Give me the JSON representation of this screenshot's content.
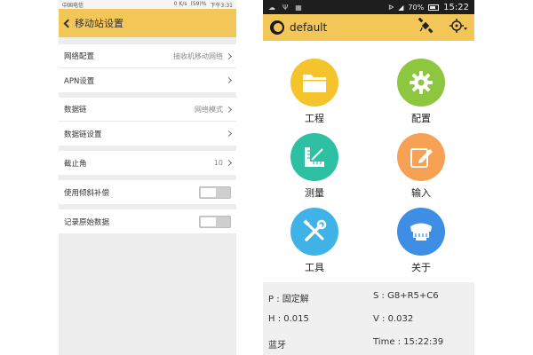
{
  "left_phone": {
    "status_bar": {
      "carrier": "中国电信",
      "net_speed": "0 K/s",
      "battery": "(59)%",
      "time": "下午3:31"
    },
    "header": {
      "title": "移动站设置"
    },
    "groups": [
      {
        "rows": [
          {
            "label": "网络配置",
            "value": "接收机移动网络"
          },
          {
            "label": "APN设置",
            "value": ""
          }
        ]
      },
      {
        "rows": [
          {
            "label": "数据链",
            "value": "网络模式"
          },
          {
            "label": "数据链设置",
            "value": ""
          }
        ]
      },
      {
        "rows": [
          {
            "label": "截止角",
            "value": "10"
          }
        ]
      },
      {
        "rows": [
          {
            "label": "使用倾斜补偿",
            "toggle": false
          }
        ]
      },
      {
        "rows": [
          {
            "label": "记录原始数据",
            "toggle": false
          }
        ]
      }
    ]
  },
  "right_phone": {
    "status_bar": {
      "battery": "70%",
      "time": "15:22"
    },
    "header": {
      "title": "default"
    },
    "tiles": [
      {
        "label": "工程",
        "color": "#f5c32c",
        "icon": "folder-icon"
      },
      {
        "label": "配置",
        "color": "#8dc63f",
        "icon": "gear-icon"
      },
      {
        "label": "测量",
        "color": "#2dc0a2",
        "icon": "ruler-icon"
      },
      {
        "label": "输入",
        "color": "#f7a154",
        "icon": "edit-icon"
      },
      {
        "label": "工具",
        "color": "#3fb3e8",
        "icon": "tools-icon"
      },
      {
        "label": "关于",
        "color": "#3d8ee4",
        "icon": "receiver-icon"
      }
    ],
    "info": {
      "position": "P : 固定解",
      "satellites": "S : G8+R5+C6",
      "h_precision": "H : 0.015",
      "v_precision": "V : 0.032",
      "connection": "蓝牙",
      "time": "Time : 15:22:39"
    }
  }
}
